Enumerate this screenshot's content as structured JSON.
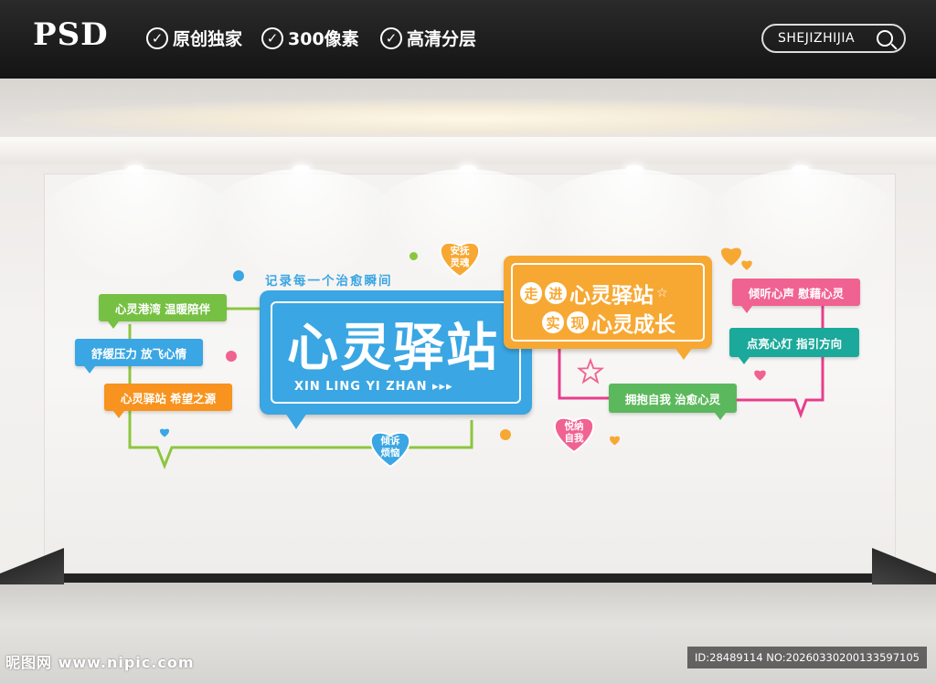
{
  "banner": {
    "logo": "PSD",
    "features": [
      "原创独家",
      "300像素",
      "高清分层"
    ],
    "search_label": "SHEJIZHIJIA"
  },
  "wall": {
    "tagline": "记录每一个治愈瞬间",
    "main_title": "心灵驿站",
    "main_subtitle": "XIN LING YI ZHAN ▸▸▸",
    "left_tags": [
      {
        "text": "心灵港湾 温暖陪伴",
        "color": "#76c043"
      },
      {
        "text": "舒缓压力 放飞心情",
        "color": "#3aa6e3"
      },
      {
        "text": "心灵驿站 希望之源",
        "color": "#f7931e"
      }
    ],
    "hearts": [
      {
        "line1": "安抚",
        "line2": "灵魂",
        "color": "#f7a833"
      },
      {
        "line1": "倾诉",
        "line2": "烦恼",
        "color": "#3aa6e3"
      },
      {
        "line1": "悦纳",
        "line2": "自我",
        "color": "#f06292"
      }
    ],
    "orange_box": {
      "line1_a": "走",
      "line1_b": "进",
      "line1_rest": "心灵驿站",
      "line2_a": "实",
      "line2_b": "现",
      "line2_rest": "心灵成长"
    },
    "right_tags": [
      {
        "text": "倾听心声 慰藉心灵",
        "color": "#f06292"
      },
      {
        "text": "点亮心灯 指引方向",
        "color": "#1aa99a"
      },
      {
        "text": "拥抱自我 治愈心灵",
        "color": "#5cb85c"
      }
    ]
  },
  "watermark": {
    "left": "昵图网 www.nipic.com",
    "right": "ID:28489114 NO:20260330200133597105"
  }
}
